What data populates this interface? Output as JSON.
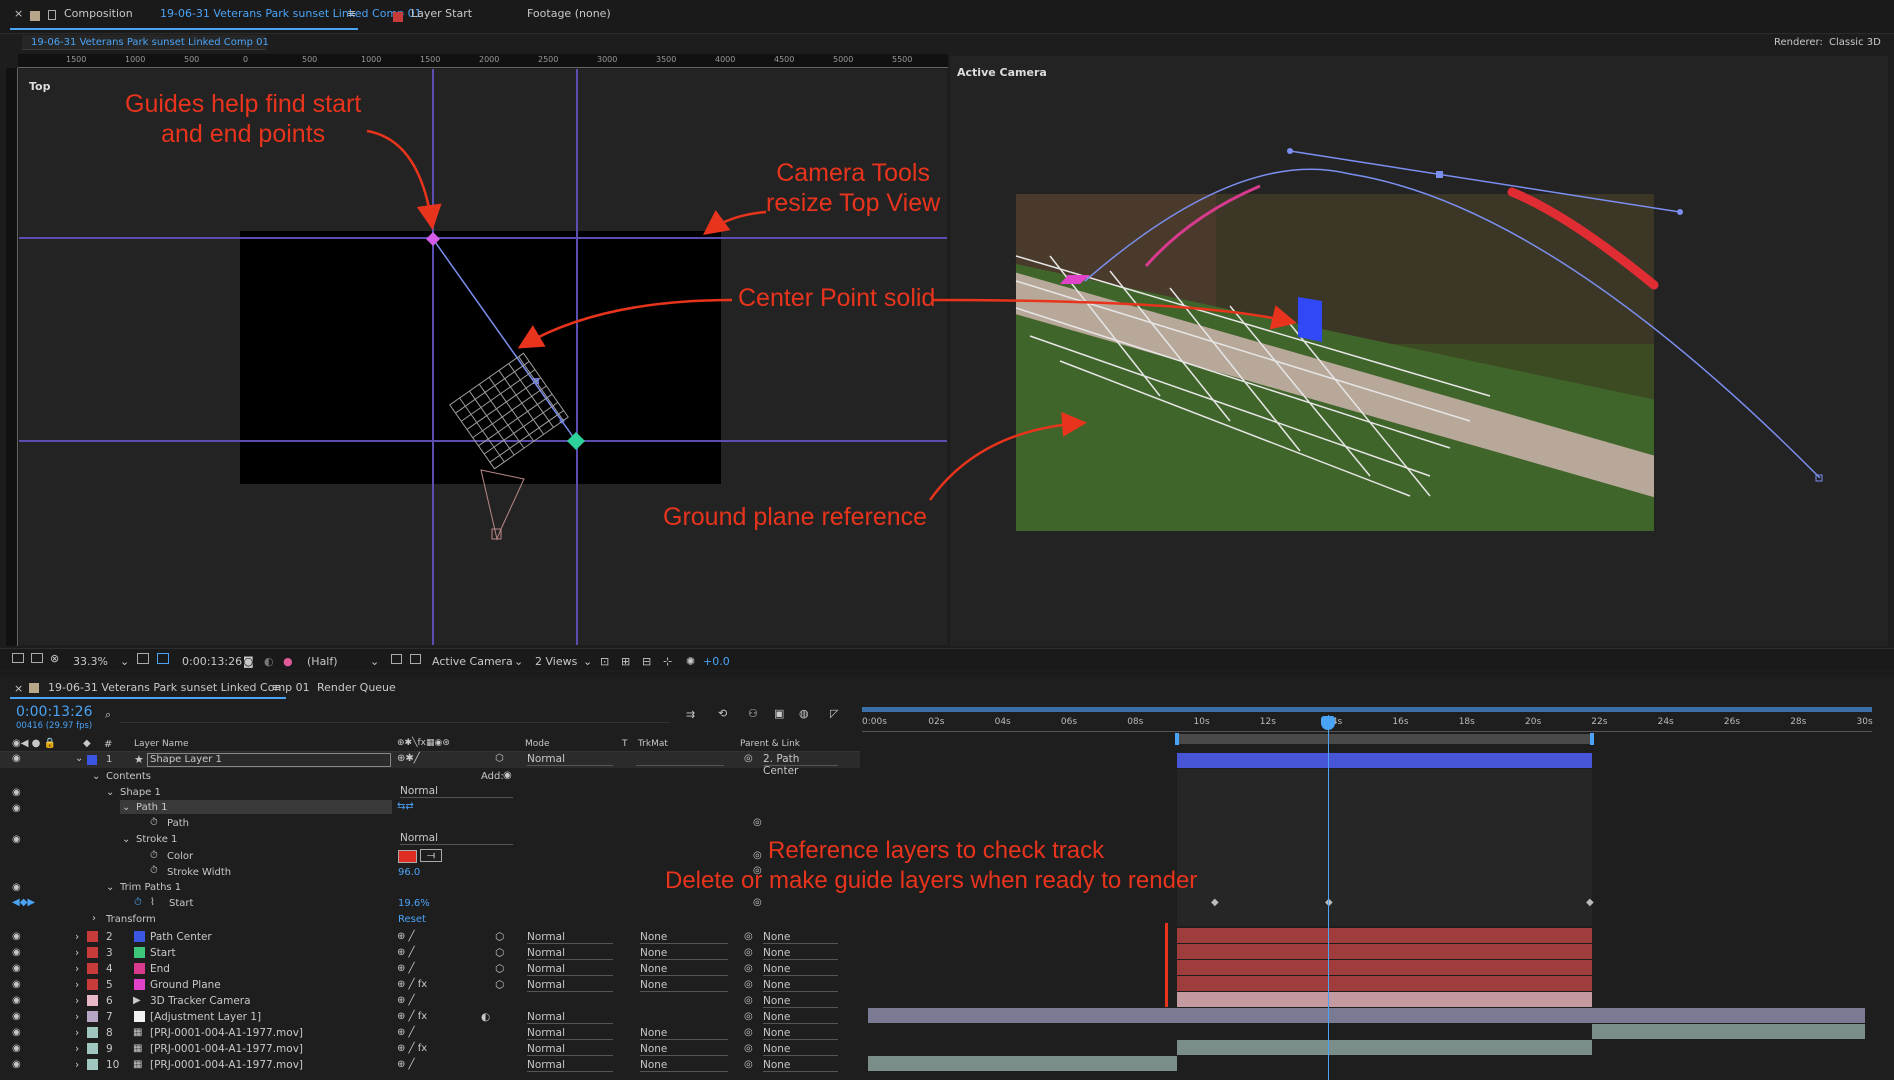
{
  "composition_tab": {
    "prefix": "Composition",
    "name": "19-06-31 Veterans Park sunset Linked Comp 01"
  },
  "layer_tab": "Layer Start",
  "footage_tab": "Footage (none)",
  "flow_tab": "19-06-31 Veterans Park sunset Linked Comp 01",
  "renderer": {
    "label": "Renderer:",
    "value": "Classic 3D"
  },
  "ruler_labels": [
    "1500",
    "1000",
    "500",
    "0",
    "500",
    "1000",
    "1500",
    "2000",
    "2500",
    "3000",
    "3500",
    "4000",
    "4500",
    "5000",
    "5500"
  ],
  "views": {
    "left": "Top",
    "right": "Active Camera"
  },
  "annotations": {
    "guides": "Guides help find start\nand end points",
    "camera_tools": "Camera Tools\nresize Top View",
    "center_point": "Center Point solid",
    "ground_plane": "Ground plane reference",
    "reference": "Reference layers to check track",
    "delete": "Delete or make guide layers when ready to render"
  },
  "viewer_toolbar": {
    "zoom": "33.3%",
    "timecode": "0:00:13:26",
    "resolution": "(Half)",
    "camera": "Active Camera",
    "views": "2 Views",
    "exposure": "+0.0"
  },
  "timeline": {
    "tab": "19-06-31 Veterans Park sunset Linked Comp 01",
    "render_queue": "Render Queue",
    "timecode": "0:00:13:26",
    "frame": "00416 (29.97 fps)",
    "search_placeholder": "",
    "headers": {
      "num": "#",
      "layer_name": "Layer Name",
      "mode": "Mode",
      "t": "T",
      "trkmat": "TrkMat",
      "parent": "Parent & Link"
    },
    "ticks": [
      "0:00s",
      "02s",
      "04s",
      "06s",
      "08s",
      "10s",
      "12s",
      "14s",
      "16s",
      "18s",
      "20s",
      "22s",
      "24s",
      "26s",
      "28s",
      "30s"
    ],
    "layer1": {
      "num": "1",
      "name": "Shape Layer 1",
      "mode": "Normal",
      "parent": "2. Path Center"
    },
    "contents": "Contents",
    "add": "Add:",
    "shape1": "Shape 1",
    "shape1_mode": "Normal",
    "path1": "Path 1",
    "path": "Path",
    "stroke1": "Stroke 1",
    "stroke1_mode": "Normal",
    "color": "Color",
    "stroke_width": "Stroke Width",
    "stroke_width_value": "96.0",
    "trim_paths": "Trim Paths 1",
    "start": "Start",
    "start_value": "19.6%",
    "transform": "Transform",
    "reset": "Reset",
    "layers": [
      {
        "num": "2",
        "name": "Path Center",
        "color": "#3b56e0",
        "mode": "Normal",
        "trkmat": "None",
        "parent": "None"
      },
      {
        "num": "3",
        "name": "Start",
        "color": "#3ec77a",
        "mode": "Normal",
        "trkmat": "None",
        "parent": "None"
      },
      {
        "num": "4",
        "name": "End",
        "color": "#d83a8e",
        "mode": "Normal",
        "trkmat": "None",
        "parent": "None"
      },
      {
        "num": "5",
        "name": "Ground Plane",
        "color": "#e043c9",
        "mode": "Normal",
        "trkmat": "None",
        "parent": "None"
      },
      {
        "num": "6",
        "name": "3D Tracker Camera",
        "color": "",
        "mode": "",
        "trkmat": "",
        "parent": "None"
      },
      {
        "num": "7",
        "name": "[Adjustment Layer 1]",
        "color": "#f2f2f2",
        "mode": "Normal",
        "trkmat": "",
        "parent": "None"
      },
      {
        "num": "8",
        "name": "[PRJ-0001-004-A1-1977.mov]",
        "color": "",
        "mode": "Normal",
        "trkmat": "None",
        "parent": "None"
      },
      {
        "num": "9",
        "name": "[PRJ-0001-004-A1-1977.mov]",
        "color": "",
        "mode": "Normal",
        "trkmat": "None",
        "parent": "None"
      },
      {
        "num": "10",
        "name": "[PRJ-0001-004-A1-1977.mov]",
        "color": "",
        "mode": "Normal",
        "trkmat": "None",
        "parent": "None"
      }
    ]
  },
  "colors": {
    "accent": "#4aa3f5",
    "annotation": "#e8341c",
    "guide": "#5a4fb0",
    "layer_bar": "#9e3d3b",
    "shape_bar": "#4656d6"
  }
}
